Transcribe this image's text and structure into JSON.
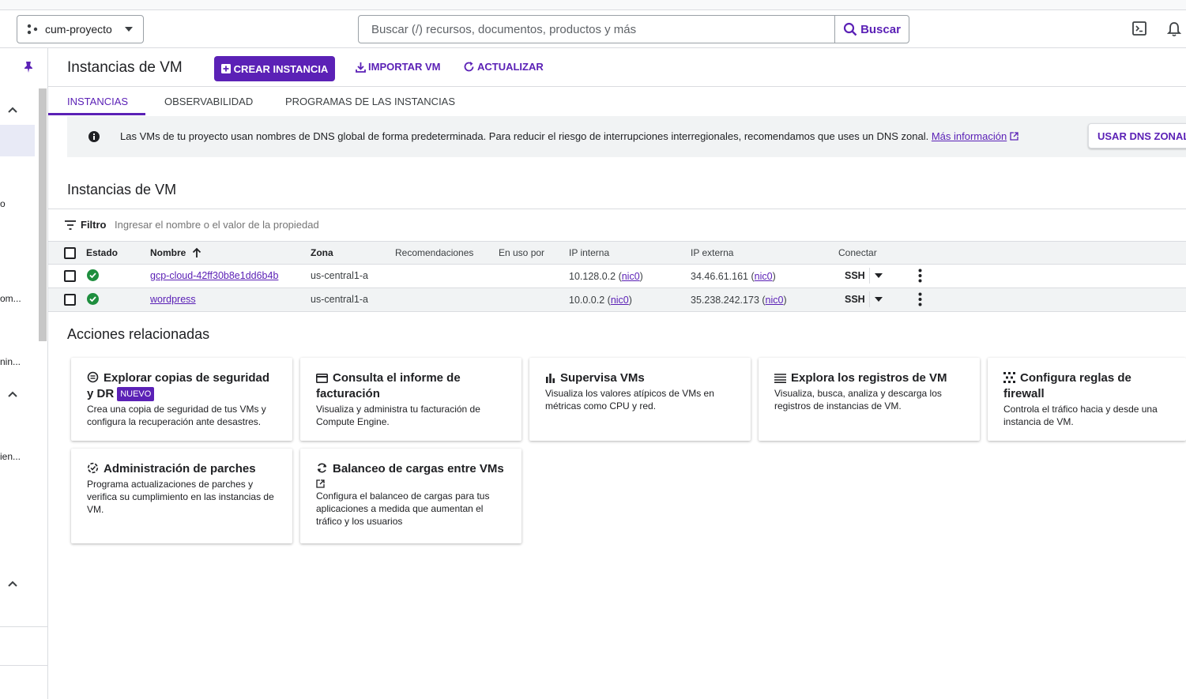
{
  "topbar": {
    "project_name": "cum-proyecto",
    "search_placeholder": "Buscar (/) recursos, documentos, productos y más",
    "search_button": "Buscar"
  },
  "leftnav": {
    "truncated_labels": [
      "o",
      "om...",
      "nin...",
      "ien..."
    ]
  },
  "header": {
    "title": "Instancias de VM",
    "create_button": "CREAR INSTANCIA",
    "import_button": "IMPORTAR VM",
    "refresh_button": "ACTUALIZAR"
  },
  "tabs": [
    "INSTANCIAS",
    "OBSERVABILIDAD",
    "PROGRAMAS DE LAS INSTANCIAS"
  ],
  "banner": {
    "text": "Las VMs de tu proyecto usan nombres de DNS global de forma predeterminada. Para reducir el riesgo de interrupciones interregionales, recomendamos que uses un DNS zonal.",
    "link": "Más información",
    "button": "USAR DNS ZONAL"
  },
  "section_title": "Instancias de VM",
  "filter": {
    "label": "Filtro",
    "placeholder": "Ingresar el nombre o el valor de la propiedad"
  },
  "table": {
    "columns": [
      "Estado",
      "Nombre",
      "Zona",
      "Recomendaciones",
      "En uso por",
      "IP interna",
      "IP externa",
      "Conectar"
    ],
    "rows": [
      {
        "name": "gcp-cloud-42ff30b8e1dd6b4b",
        "zone": "us-central1-a",
        "internal_ip": "10.128.0.2",
        "internal_nic": "nic0",
        "external_ip": "34.46.61.161",
        "external_nic": "nic0",
        "connect": "SSH"
      },
      {
        "name": "wordpress",
        "zone": "us-central1-a",
        "internal_ip": "10.0.0.2",
        "internal_nic": "nic0",
        "external_ip": "35.238.242.173",
        "external_nic": "nic0",
        "connect": "SSH"
      }
    ]
  },
  "related": {
    "title": "Acciones relacionadas",
    "new_badge": "NUEVO",
    "cards": [
      {
        "title": "Explorar copias de seguridad y DR",
        "desc": "Crea una copia de seguridad de tus VMs y configura la recuperación ante desastres.",
        "icon": "backup-icon"
      },
      {
        "title": "Consulta el informe de facturación",
        "desc": "Visualiza y administra tu facturación de Compute Engine.",
        "icon": "billing-card-icon"
      },
      {
        "title": "Supervisa VMs",
        "desc": "Visualiza los valores atípicos de VMs en métricas como CPU y red.",
        "icon": "bar-chart-icon"
      },
      {
        "title": "Explora los registros de VM",
        "desc": "Visualiza, busca, analiza y descarga los registros de instancias de VM.",
        "icon": "list-icon"
      },
      {
        "title": "Configura reglas de firewall",
        "desc": "Controla el tráfico hacia y desde una instancia de VM.",
        "icon": "firewall-grid-icon"
      },
      {
        "title": "Administración de parches",
        "desc": "Programa actualizaciones de parches y verifica su cumplimiento en las instancias de VM.",
        "icon": "patch-sync-icon"
      },
      {
        "title": "Balanceo de cargas entre VMs",
        "desc": "Configura el balanceo de cargas para tus aplicaciones a medida que aumentan el tráfico y los usuarios",
        "icon": "refresh-icon"
      }
    ]
  },
  "colors": {
    "accent": "#5b21b6",
    "status_ok": "#1e8e3e"
  }
}
